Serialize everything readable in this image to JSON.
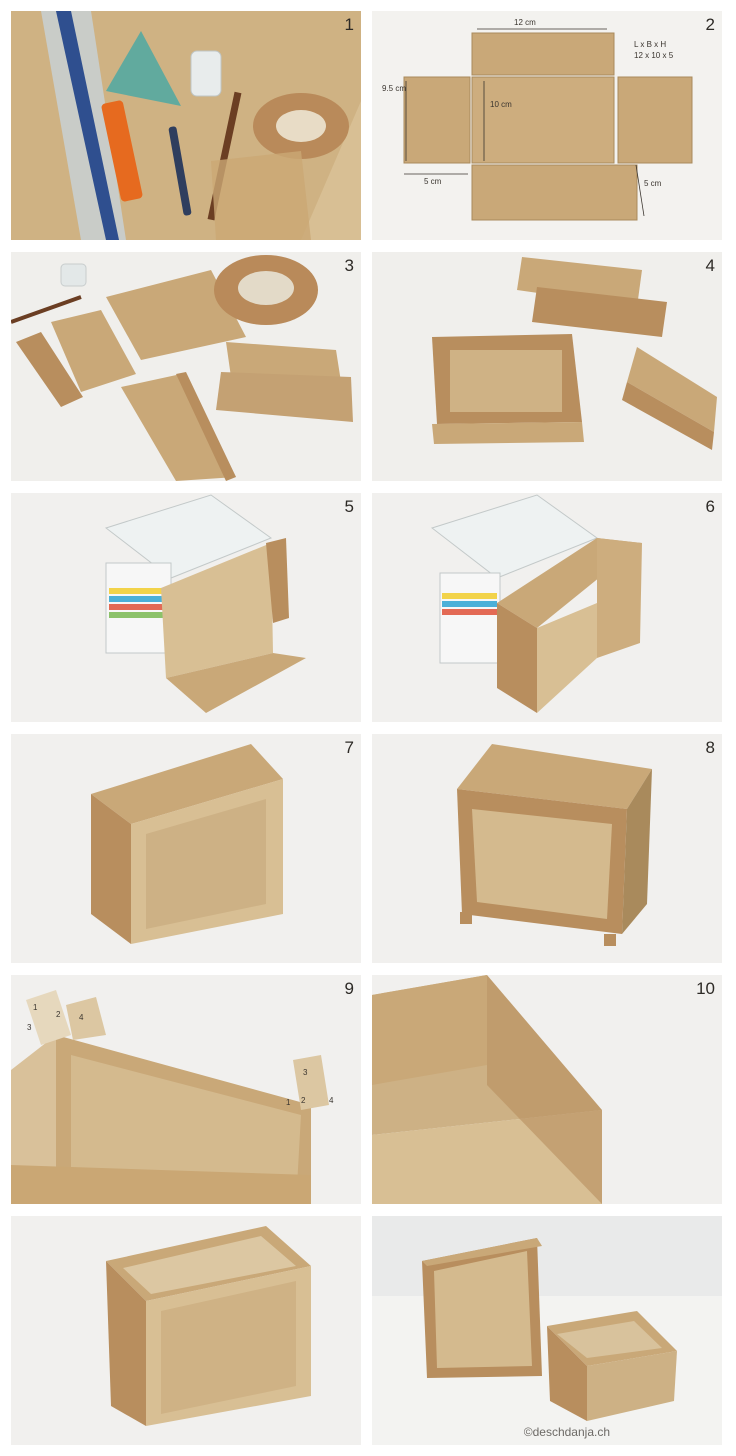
{
  "steps": [
    {
      "number": "1"
    },
    {
      "number": "2"
    },
    {
      "number": "3"
    },
    {
      "number": "4"
    },
    {
      "number": "5"
    },
    {
      "number": "6"
    },
    {
      "number": "7"
    },
    {
      "number": "8"
    },
    {
      "number": "9"
    },
    {
      "number": "10"
    },
    {
      "number": ""
    },
    {
      "number": ""
    }
  ],
  "dimensions": {
    "length": "12 cm",
    "height_side": "9.5 cm",
    "inner": "10 cm",
    "flap_left": "5 cm",
    "flap_bottom": "5 cm",
    "legend_line1": "L x B x H",
    "legend_line2": "12 x 10 x 5"
  },
  "tape_marks": [
    "1",
    "2",
    "3",
    "4",
    "1",
    "2",
    "3",
    "4"
  ],
  "credit": "©deschdanja.ch",
  "colors": {
    "cardboard": "#c9a878",
    "cardboard_dark": "#a98a5c",
    "tape": "#b88e5e",
    "background": "#f1f0ed"
  }
}
